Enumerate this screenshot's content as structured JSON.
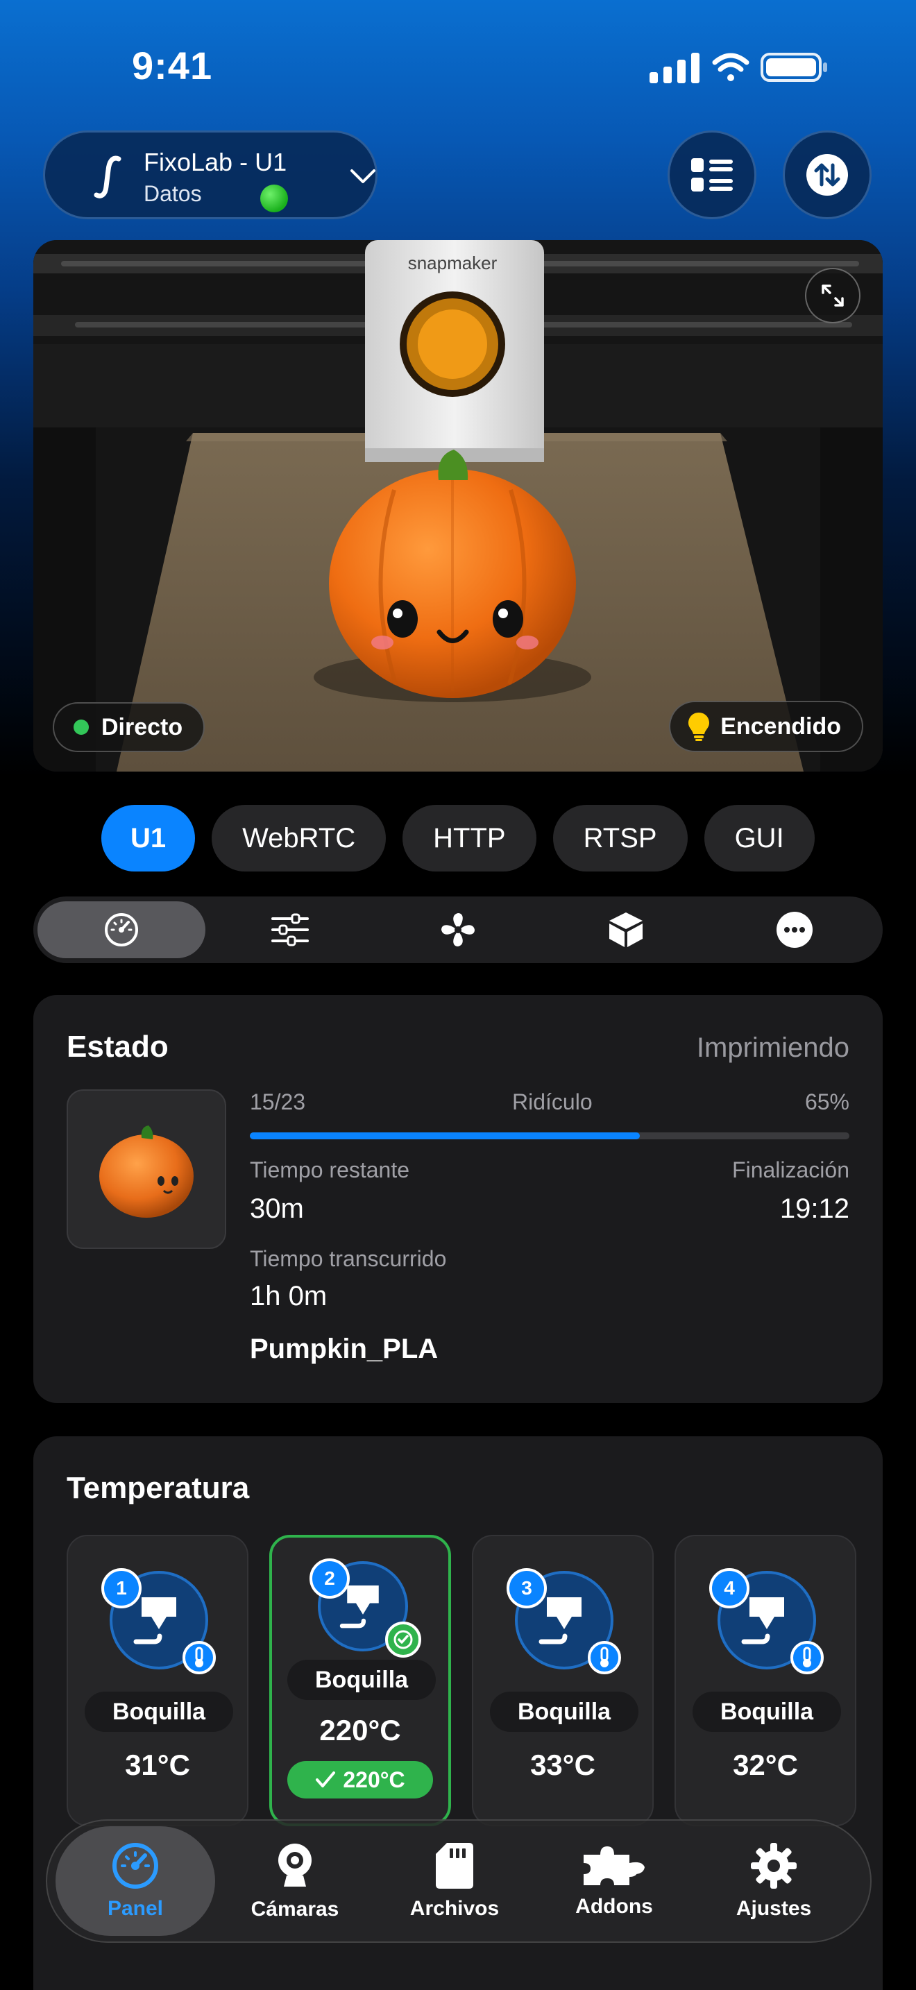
{
  "status_bar": {
    "time": "9:41"
  },
  "header": {
    "printer_name": "FixoLab - U1",
    "printer_subtitle": "Datos",
    "connection_color": "#33c759"
  },
  "camera": {
    "live_label": "Directo",
    "light_label": "Encendido",
    "brand_text": "snapmaker"
  },
  "sources": [
    {
      "label": "U1",
      "active": true
    },
    {
      "label": "WebRTC",
      "active": false
    },
    {
      "label": "HTTP",
      "active": false
    },
    {
      "label": "RTSP",
      "active": false
    },
    {
      "label": "GUI",
      "active": false
    }
  ],
  "segments": [
    {
      "icon": "gauge-icon",
      "active": true
    },
    {
      "icon": "sliders-icon",
      "active": false
    },
    {
      "icon": "fan-icon",
      "active": false
    },
    {
      "icon": "box-icon",
      "active": false
    },
    {
      "icon": "more-icon",
      "active": false
    }
  ],
  "estado": {
    "title": "Estado",
    "status": "Imprimiendo",
    "layer": "15/23",
    "speed": "Ridículo",
    "percent_label": "65%",
    "progress": 0.65,
    "remaining_label": "Tiempo restante",
    "remaining_value": "30m",
    "finish_label": "Finalización",
    "finish_value": "19:12",
    "elapsed_label": "Tiempo transcurrido",
    "elapsed_value": "1h 0m",
    "file_name": "Pumpkin_PLA"
  },
  "temperatura": {
    "title": "Temperatura",
    "tiles": [
      {
        "number": "1",
        "label": "Boquilla",
        "temp": "31°C",
        "selected": false
      },
      {
        "number": "2",
        "label": "Boquilla",
        "temp": "220°C",
        "target": "220°C",
        "selected": true
      },
      {
        "number": "3",
        "label": "Boquilla",
        "temp": "33°C",
        "selected": false
      },
      {
        "number": "4",
        "label": "Boquilla",
        "temp": "32°C",
        "selected": false
      }
    ]
  },
  "tabbar": [
    {
      "label": "Panel",
      "icon": "gauge-icon",
      "active": true
    },
    {
      "label": "Cámaras",
      "icon": "webcam-icon",
      "active": false
    },
    {
      "label": "Archivos",
      "icon": "sd-card-icon",
      "active": false
    },
    {
      "label": "Addons",
      "icon": "puzzle-icon",
      "active": false
    },
    {
      "label": "Ajustes",
      "icon": "gear-icon",
      "active": false
    }
  ],
  "colors": {
    "accent": "#0a84ff",
    "success": "#2fb34c",
    "card": "#1b1b1d"
  }
}
